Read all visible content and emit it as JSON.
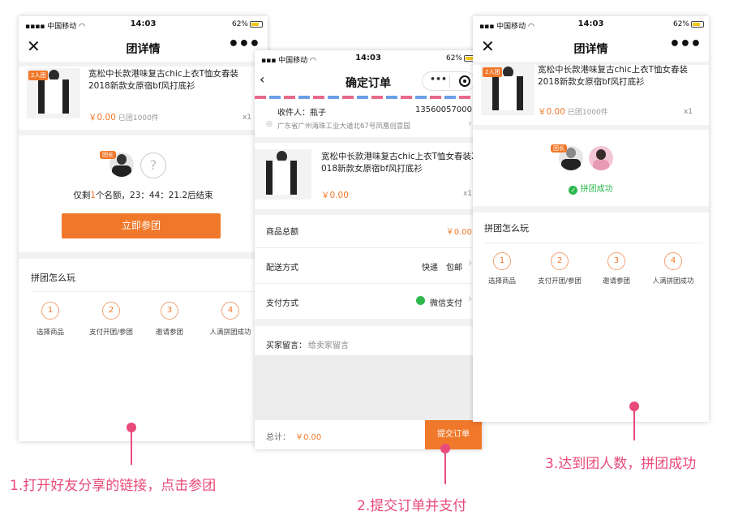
{
  "status": {
    "carrier": "中国移动",
    "time": "14:03",
    "battery": "62%"
  },
  "group_detail": {
    "title": "团详情",
    "close": "✕",
    "more": "•••",
    "product": {
      "badge": "2人团",
      "title_line1": "宽松中长款港味复古chic上衣T恤女春装",
      "title_line2": "2018新款女原宿bf风打底衫",
      "price": "￥0.00",
      "sold": "已团1000件",
      "qty": "x1"
    },
    "leader_tag": "团长",
    "unknown": "?",
    "remain_prefix": "仅剩",
    "remain_count": "1",
    "remain_suffix": "个名额，23：44：21.2后结束",
    "join_button": "立即参团",
    "how_title": "拼团怎么玩",
    "success": "拼团成功",
    "steps": [
      {
        "num": "1",
        "label": "选择商品"
      },
      {
        "num": "2",
        "label": "支付开团/参团"
      },
      {
        "num": "3",
        "label": "邀请参团"
      },
      {
        "num": "4",
        "label": "人满拼团成功"
      }
    ]
  },
  "confirm_order": {
    "title": "确定订单",
    "more": "•••",
    "receiver_label": "收件人：",
    "receiver_name": "瓶子",
    "phone": "13560057000",
    "address": "广东省广州海珠工业大道北67号凤凰创意园",
    "product": {
      "title_line1": "宽松中长款港味复古chic上衣T恤女春装2",
      "title_line2": "018新款女原宿bf风打底衫",
      "price": "￥0.00",
      "qty": "x1"
    },
    "total_label": "商品总额",
    "total_value": "￥0.00",
    "delivery_label": "配送方式",
    "delivery_value": "快递　包邮",
    "pay_label": "支付方式",
    "pay_value": "微信支付",
    "note_label": "买家留言：",
    "note_placeholder": "给卖家留言",
    "sum_label": "总计：",
    "sum_value": "￥0.00",
    "submit": "提交订单"
  },
  "captions": {
    "c1": "1.打开好友分享的链接，点击参团",
    "c2": "2.提交订单并支付",
    "c3": "3.达到团人数，拼团成功"
  },
  "colors": {
    "accent": "#f0782a",
    "caption": "#e84a7a",
    "success": "#2db84d"
  }
}
